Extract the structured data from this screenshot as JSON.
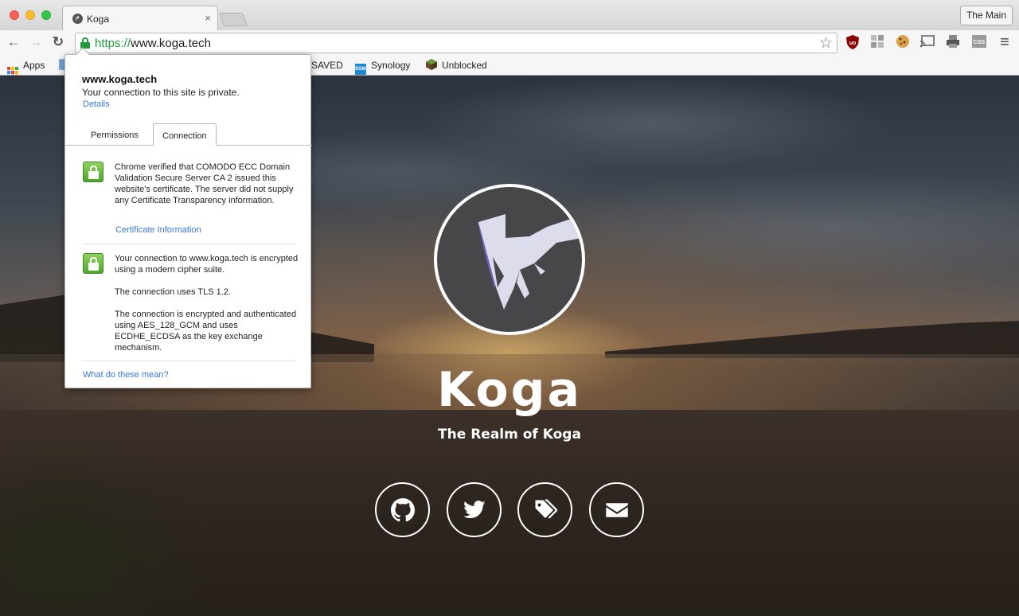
{
  "browser": {
    "tab_title": "Koga",
    "tab_close": "×",
    "profile_button": "The Main",
    "url_scheme": "https://",
    "url_host": "www.koga.tech",
    "bookmarks": [
      {
        "label": "Apps"
      },
      {
        "label": "SAVED"
      },
      {
        "label": "Synology",
        "icon_text": "DSM"
      },
      {
        "label": "Unblocked"
      }
    ],
    "nav": {
      "back": "←",
      "forward": "→",
      "reload": "↻"
    },
    "star": "☆",
    "extensions": [
      "ublock-icon",
      "grid-icon",
      "cookie-icon",
      "cast-icon",
      "printer-icon",
      "css-icon"
    ],
    "menu_icon": "≡"
  },
  "popup": {
    "host": "www.koga.tech",
    "private_message": "Your connection to this site is private.",
    "details_link": "Details",
    "tabs": [
      {
        "label": "Permissions",
        "active": false
      },
      {
        "label": "Connection",
        "active": true
      }
    ],
    "section1_text": "Chrome verified that COMODO ECC Domain Validation Secure Server CA 2 issued this website's certificate. The server did not supply any Certificate Transparency information.",
    "cert_link": "Certificate Information",
    "section2_p1": "Your connection to www.koga.tech is encrypted using a modern cipher suite.",
    "section2_p2": "The connection uses TLS 1.2.",
    "section2_p3": "The connection is encrypted and authenticated using AES_128_GCM and uses ECDHE_ECDSA as the key exchange mechanism.",
    "help_link": "What do these mean?"
  },
  "site": {
    "title": "Koga",
    "tagline": "The Realm of Koga",
    "social": [
      "github-icon",
      "twitter-icon",
      "tag-icon",
      "envelope-icon"
    ]
  },
  "colors": {
    "secure_green": "#1e9e3a",
    "link_blue": "#3b77d6"
  }
}
